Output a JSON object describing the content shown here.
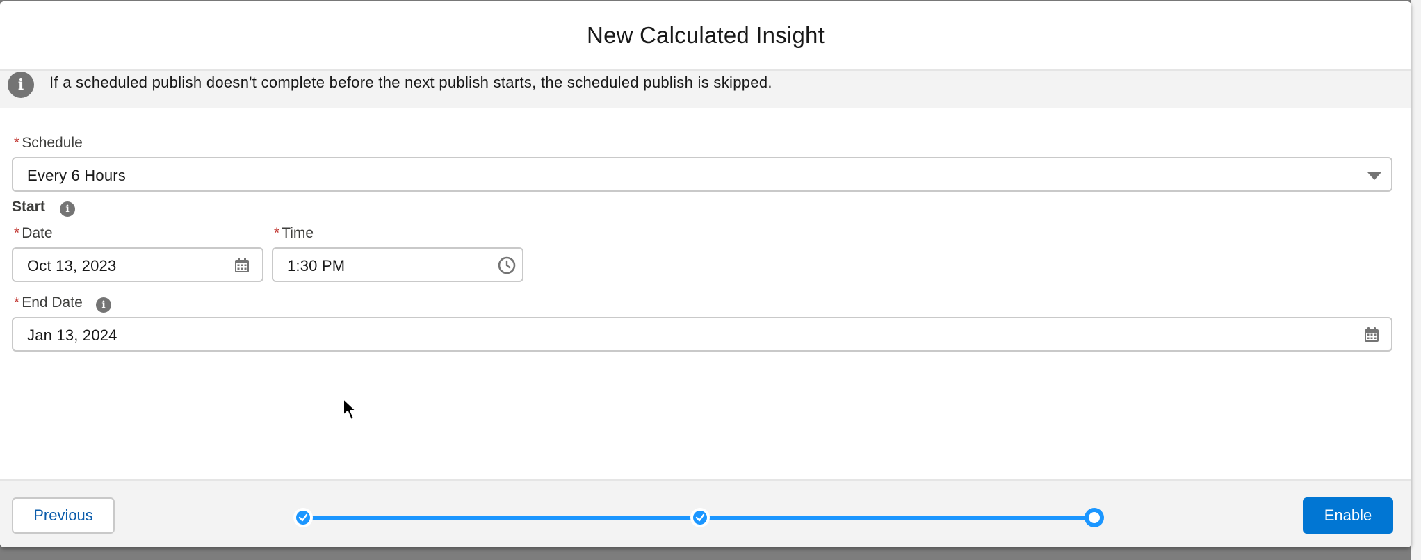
{
  "modal": {
    "title": "New Calculated Insight"
  },
  "info_banner": {
    "icon": "info-icon",
    "text": "If a scheduled publish doesn't complete before the next publish starts, the scheduled publish is skipped."
  },
  "form": {
    "required_marker": "*",
    "schedule": {
      "label": "Schedule",
      "value": "Every 6 Hours"
    },
    "start": {
      "label": "Start",
      "date": {
        "label": "Date",
        "value": "Oct 13, 2023",
        "icon": "calendar-icon"
      },
      "time": {
        "label": "Time",
        "value": "1:30 PM",
        "icon": "clock-icon"
      }
    },
    "end_date": {
      "label": "End Date",
      "value": "Jan 13, 2024",
      "icon": "calendar-icon"
    }
  },
  "footer": {
    "previous_label": "Previous",
    "enable_label": "Enable",
    "progress": {
      "steps": [
        {
          "status": "complete"
        },
        {
          "status": "complete"
        },
        {
          "status": "current"
        }
      ]
    }
  },
  "colors": {
    "brand": "#0176d3",
    "progress": "#1b96ff",
    "required": "#c23934",
    "link": "#0b5cab"
  }
}
